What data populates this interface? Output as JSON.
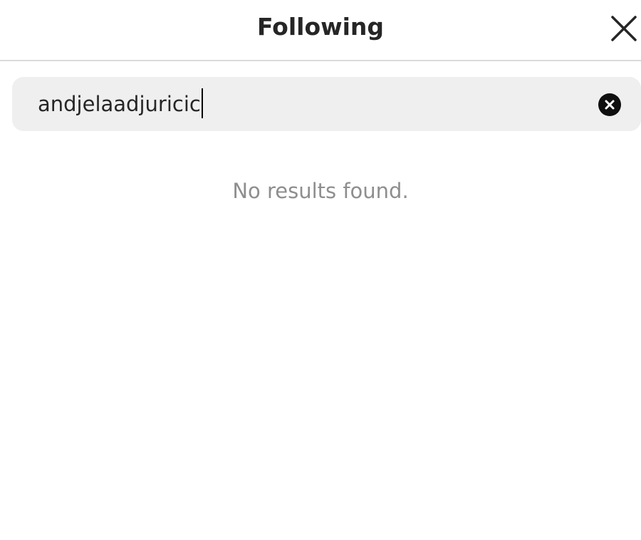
{
  "header": {
    "title": "Following",
    "close_icon": "close-icon"
  },
  "search": {
    "value": "andjelaadjuricic",
    "clear_icon": "clear-circle-icon"
  },
  "results": {
    "empty_message": "No results found."
  },
  "colors": {
    "search_bg": "#efefef",
    "divider": "#dbdbdb",
    "muted_text": "#8e8e8e",
    "spellcheck": "#e0342a"
  }
}
